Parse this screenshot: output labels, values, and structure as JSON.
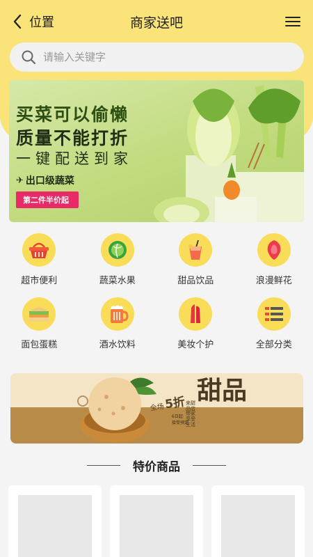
{
  "nav": {
    "back_label": "位置",
    "title": "商家送吧"
  },
  "search": {
    "placeholder": "请输入关键字"
  },
  "banner": {
    "line1": "买菜可以偷懒",
    "line2": "质量不能打折",
    "line3": "一键配送到家",
    "tag": "出口级蔬菜",
    "badge": "第二件半价起"
  },
  "categories": [
    {
      "label": "超市便利",
      "icon": "basket-icon"
    },
    {
      "label": "蔬菜水果",
      "icon": "cabbage-icon"
    },
    {
      "label": "甜品饮品",
      "icon": "drink-icon"
    },
    {
      "label": "浪漫鲜花",
      "icon": "flower-icon"
    },
    {
      "label": "面包蛋糕",
      "icon": "sandwich-icon"
    },
    {
      "label": "酒水饮料",
      "icon": "beer-icon"
    },
    {
      "label": "美妆个护",
      "icon": "lipstick-icon"
    },
    {
      "label": "全部分类",
      "icon": "list-icon"
    }
  ],
  "dessert_banner": {
    "title": "甜品",
    "sale_prefix": "全场",
    "sale_value": "5折",
    "sale_note1": "6日起",
    "sale_note2": "接受预定",
    "side_text": "来甜品店带家享受生活"
  },
  "section": {
    "title": "特价商品"
  },
  "colors": {
    "header_yellow": "#fae47a",
    "icon_yellow": "#f9dc58",
    "badge_pink": "#e82a66"
  }
}
